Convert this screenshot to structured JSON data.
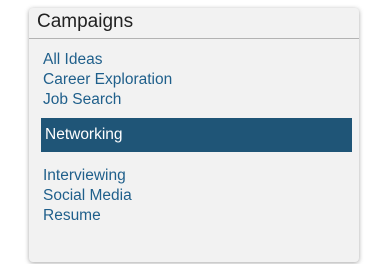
{
  "sidebar": {
    "title": "Campaigns",
    "items": [
      {
        "label": "All Ideas"
      },
      {
        "label": "Career Exploration"
      },
      {
        "label": "Job Search"
      },
      {
        "label": "Networking",
        "active": true
      },
      {
        "label": "Interviewing"
      },
      {
        "label": "Social Media"
      },
      {
        "label": "Resume"
      }
    ]
  },
  "colors": {
    "link": "#1f5f8b",
    "active_background": "#1f5577",
    "active_text": "#ffffff",
    "panel_background": "#f2f2f2"
  }
}
